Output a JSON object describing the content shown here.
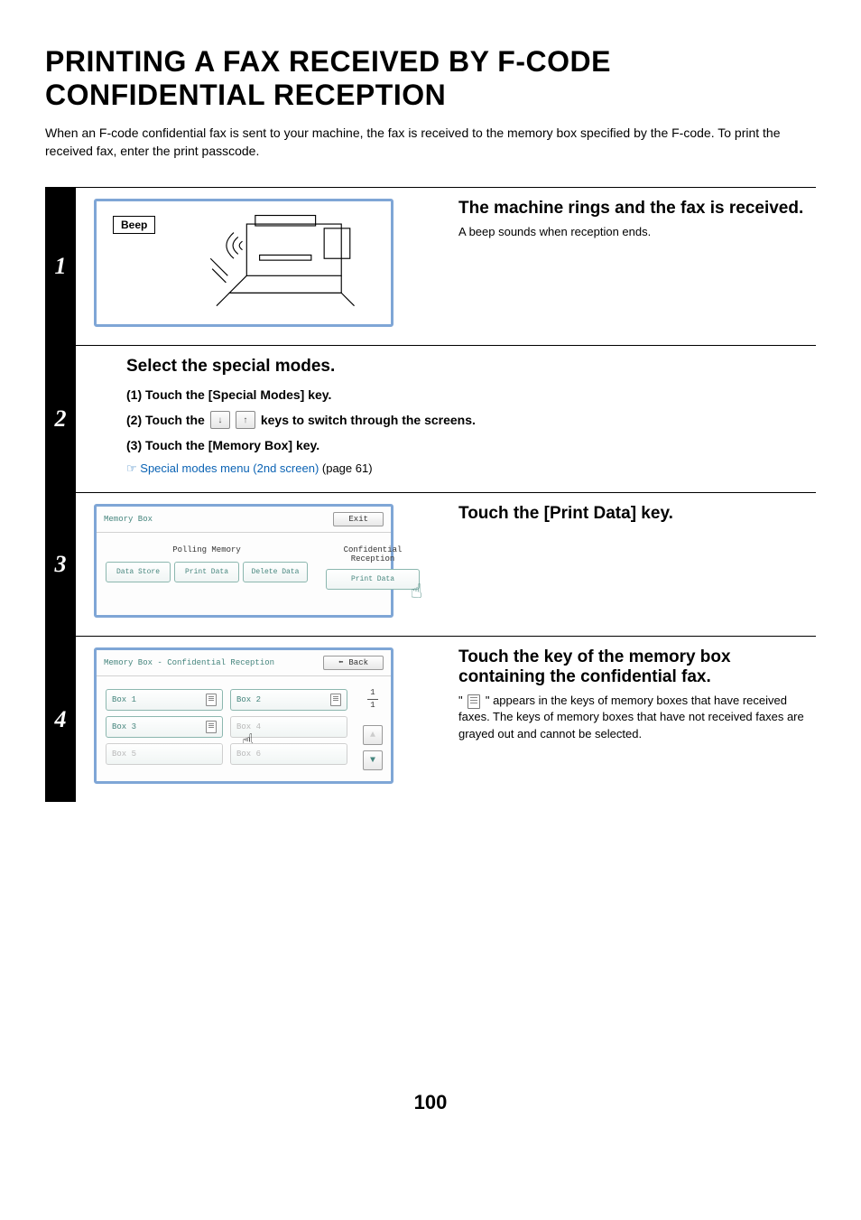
{
  "title": "PRINTING A FAX RECEIVED BY F-CODE CONFIDENTIAL RECEPTION",
  "intro": "When an F-code confidential fax is sent to your machine, the fax is received to the memory box specified by the F-code. To print the received fax, enter the print passcode.",
  "step1": {
    "num": "1",
    "beep_label": "Beep",
    "title": "The machine rings and the fax is received.",
    "desc": "A beep sounds when reception ends."
  },
  "step2": {
    "num": "2",
    "title": "Select the special modes.",
    "sub1": "(1)   Touch the [Special Modes] key.",
    "sub2_a": "(2)   Touch the",
    "sub2_b": "keys to switch through the screens.",
    "sub3": "(3)   Touch the [Memory Box] key.",
    "ref_icon": "☞",
    "ref_link": "Special modes menu (2nd screen)",
    "ref_suffix": " (page 61)"
  },
  "step3": {
    "num": "3",
    "title": "Touch the [Print Data] key.",
    "panel": {
      "header": "Memory Box",
      "exit": "Exit",
      "group_left": "Polling Memory",
      "btns_left": [
        "Data Store",
        "Print Data",
        "Delete Data"
      ],
      "group_right": "Confidential\nReception",
      "btn_right": "Print Data"
    }
  },
  "step4": {
    "num": "4",
    "title": "Touch the key of the memory box containing the confidential fax.",
    "desc_a": "\" ",
    "desc_b": " \" appears in the keys of memory boxes that have received faxes. The keys of memory boxes that have not received faxes are grayed out and cannot be selected.",
    "panel": {
      "header": "Memory Box - Confidential Reception",
      "back": "Back",
      "boxes": [
        "Box 1",
        "Box 2",
        "Box 3",
        "Box 4",
        "Box 5",
        "Box 6"
      ],
      "page_cur": "1",
      "page_total": "1"
    }
  },
  "page_number": "100"
}
